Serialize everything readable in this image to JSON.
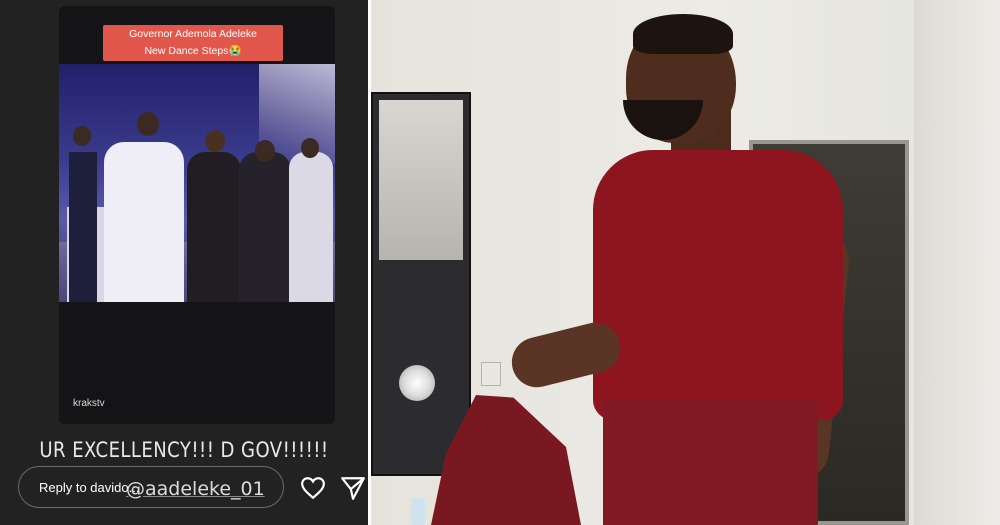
{
  "story": {
    "caption_line1": "Governor Ademola Adeleke",
    "caption_line2": "New Dance Steps😭",
    "watermark": "krakstv",
    "text": "UR EXCELLENCY!!! D GOV!!!!!!",
    "reply_placeholder": "Reply to davido...",
    "mention": "@aadeleke_01",
    "icons": [
      "heart-icon",
      "send-icon"
    ]
  },
  "photo": {
    "colors": {
      "shirt": "#8c1520",
      "wall": "#e6e3dc"
    }
  }
}
